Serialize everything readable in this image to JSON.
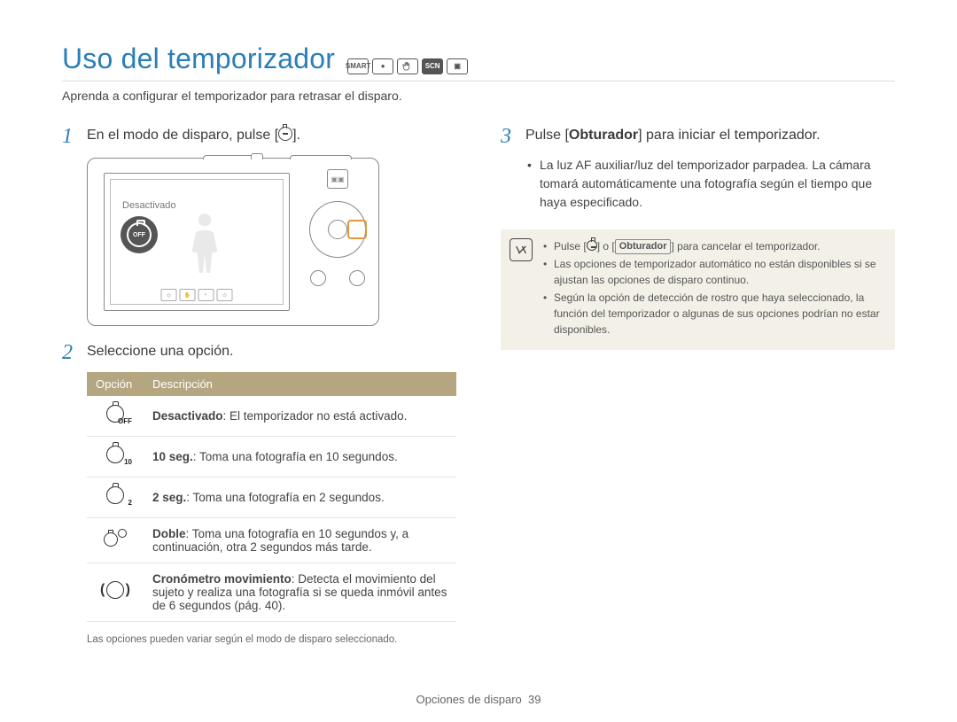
{
  "title": "Uso del temporizador",
  "mode_icons": [
    "SMART",
    "●",
    "✋",
    "SCN",
    "▣"
  ],
  "subtitle": "Aprenda a configurar el temporizador para retrasar el disparo.",
  "left": {
    "step1": {
      "num": "1",
      "text_a": "En el modo de disparo, pulse [",
      "text_b": "]."
    },
    "camera": {
      "screen_label": "Desactivado",
      "off_badge": "OFF"
    },
    "step2": {
      "num": "2",
      "text": "Seleccione una opción."
    },
    "table": {
      "head_option": "Opción",
      "head_desc": "Descripción",
      "rows": [
        {
          "icon_sub": "OFF",
          "bold": "Desactivado",
          "rest": ": El temporizador no está activado."
        },
        {
          "icon_sub": "10",
          "bold": "10 seg.",
          "rest": ": Toma una fotografía en 10 segundos."
        },
        {
          "icon_sub": "2",
          "bold": "2 seg.",
          "rest": ": Toma una fotografía en 2 segundos."
        },
        {
          "icon_type": "double",
          "bold": "Doble",
          "rest": ": Toma una fotografía en 10 segundos y, a continuación, otra 2 segundos más tarde."
        },
        {
          "icon_type": "motion",
          "bold": "Cronómetro movimiento",
          "rest": ": Detecta el movimiento del sujeto y realiza una fotografía si se queda inmóvil antes de 6 segundos (pág. 40)."
        }
      ]
    },
    "footnote": "Las opciones pueden variar según el modo de disparo seleccionado."
  },
  "right": {
    "step3": {
      "num": "3",
      "text_a": "Pulse [",
      "bold": "Obturador",
      "text_b": "] para iniciar el temporizador."
    },
    "bullets": [
      "La luz AF auxiliar/luz del temporizador parpadea. La cámara tomará automáticamente una fotografía según el tiempo que haya especificado."
    ],
    "note": {
      "item1_a": "Pulse [",
      "item1_b": "] o [",
      "item1_bold": "Obturador",
      "item1_c": "] para cancelar el temporizador.",
      "item2": "Las opciones de temporizador automático no están disponibles si se ajustan las opciones de disparo continuo.",
      "item3": "Según la opción de detección de rostro que haya seleccionado, la función del temporizador o algunas de sus opciones podrían no estar disponibles."
    }
  },
  "footer": {
    "section": "Opciones de disparo",
    "page": "39"
  }
}
